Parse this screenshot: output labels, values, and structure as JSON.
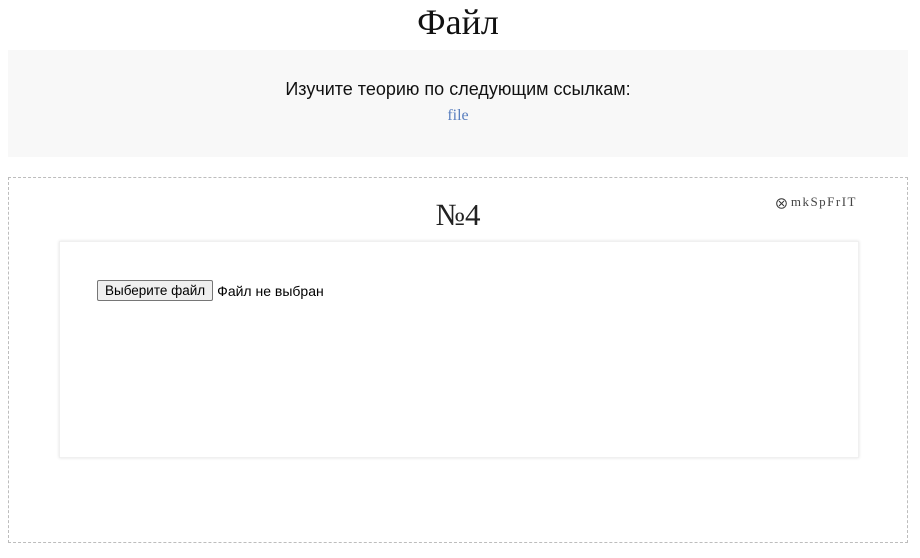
{
  "header": {
    "title": "Файл"
  },
  "theory": {
    "heading": "Изучите теорию по следующим ссылкам:",
    "links": [
      {
        "label": "file"
      }
    ]
  },
  "task": {
    "number": "№4",
    "watermark": {
      "icon": "circle-x-icon",
      "text": "mkSpFrIT"
    },
    "file_input": {
      "button_label": "Выберите файл",
      "status": "Файл не выбран"
    }
  },
  "colors": {
    "panel_background": "#f8f8f8",
    "link": "#5a7fbf",
    "frame_border": "#bdbdbd"
  }
}
